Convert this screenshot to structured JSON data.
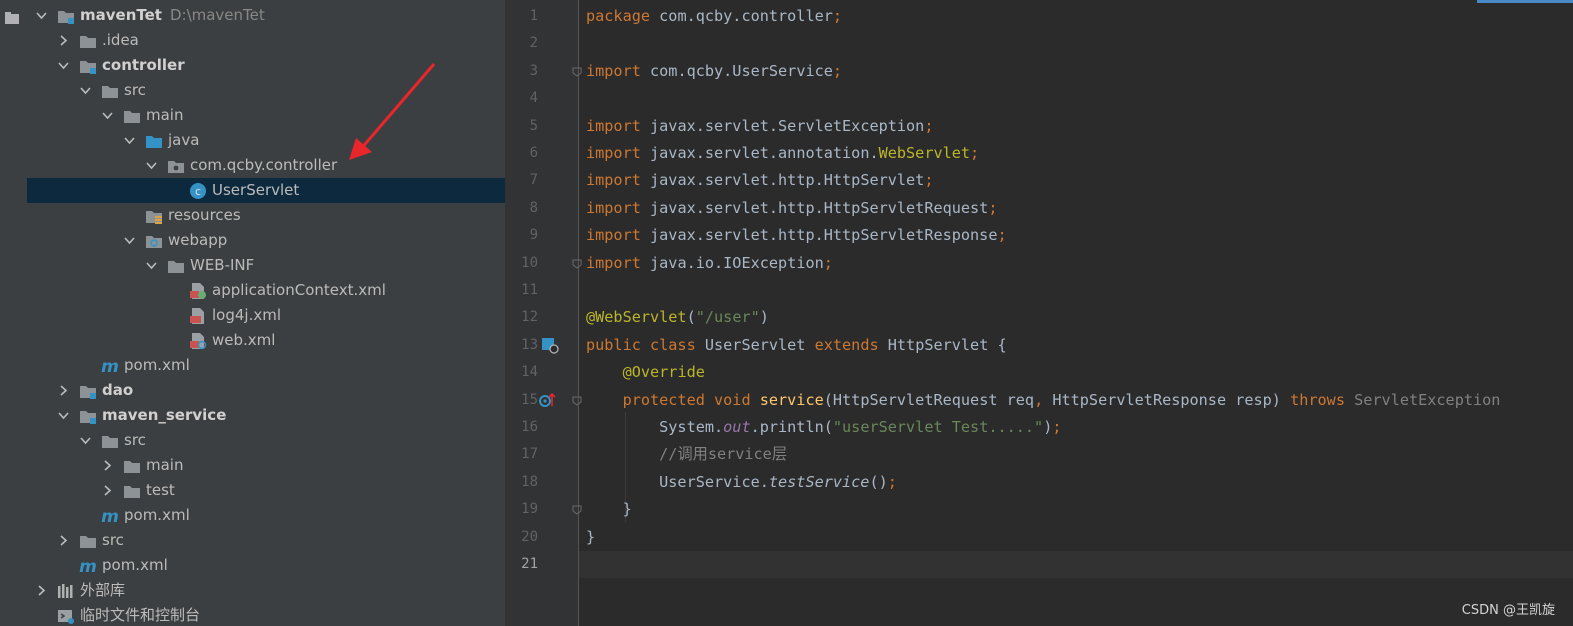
{
  "project_tree": {
    "rows": [
      {
        "label": "mavenTet",
        "path": "D:\\mavenTet",
        "bold": true,
        "indent": 0,
        "chevron": "down",
        "icon": "module-folder-icon"
      },
      {
        "label": ".idea",
        "indent": 1,
        "chevron": "right",
        "icon": "folder-icon"
      },
      {
        "label": "controller",
        "bold": true,
        "indent": 1,
        "chevron": "down",
        "icon": "module-folder-icon"
      },
      {
        "label": "src",
        "indent": 2,
        "chevron": "down",
        "icon": "folder-icon"
      },
      {
        "label": "main",
        "indent": 3,
        "chevron": "down",
        "icon": "folder-icon"
      },
      {
        "label": "java",
        "indent": 4,
        "chevron": "down",
        "icon": "source-folder-icon"
      },
      {
        "label": "com.qcby.controller",
        "indent": 5,
        "chevron": "down",
        "icon": "package-icon"
      },
      {
        "label": "UserServlet",
        "indent": 6,
        "chevron": "none",
        "icon": "class-icon",
        "selected": true
      },
      {
        "label": "resources",
        "indent": 4,
        "chevron": "none",
        "icon": "resources-folder-icon"
      },
      {
        "label": "webapp",
        "indent": 4,
        "chevron": "down",
        "icon": "web-folder-icon"
      },
      {
        "label": "WEB-INF",
        "indent": 5,
        "chevron": "down",
        "icon": "folder-icon"
      },
      {
        "label": "applicationContext.xml",
        "indent": 6,
        "chevron": "none",
        "icon": "spring-xml-icon"
      },
      {
        "label": "log4j.xml",
        "indent": 6,
        "chevron": "none",
        "icon": "xml-file-icon"
      },
      {
        "label": "web.xml",
        "indent": 6,
        "chevron": "none",
        "icon": "web-xml-icon"
      },
      {
        "label": "pom.xml",
        "indent": 2,
        "chevron": "none",
        "icon": "maven-icon"
      },
      {
        "label": "dao",
        "bold": true,
        "indent": 1,
        "chevron": "right",
        "icon": "module-folder-icon"
      },
      {
        "label": "maven_service",
        "bold": true,
        "indent": 1,
        "chevron": "down",
        "icon": "module-folder-icon"
      },
      {
        "label": "src",
        "indent": 2,
        "chevron": "down",
        "icon": "folder-icon"
      },
      {
        "label": "main",
        "indent": 3,
        "chevron": "right",
        "icon": "folder-icon"
      },
      {
        "label": "test",
        "indent": 3,
        "chevron": "right",
        "icon": "folder-icon"
      },
      {
        "label": "pom.xml",
        "indent": 2,
        "chevron": "none",
        "icon": "maven-icon"
      },
      {
        "label": "src",
        "indent": 1,
        "chevron": "right",
        "icon": "folder-icon"
      },
      {
        "label": "pom.xml",
        "indent": 1,
        "chevron": "none",
        "icon": "maven-icon"
      },
      {
        "label": "外部库",
        "indent": 0,
        "chevron": "right",
        "icon": "library-icon"
      },
      {
        "label": "临时文件和控制台",
        "indent": 0,
        "chevron": "none",
        "icon": "scratch-icon"
      }
    ]
  },
  "editor": {
    "current_line": 21,
    "lines": [
      [
        {
          "t": "package ",
          "c": "kw"
        },
        {
          "t": "com.qcby.controller"
        },
        {
          "t": ";",
          "c": "kw"
        }
      ],
      [],
      [
        {
          "t": "import ",
          "c": "kw"
        },
        {
          "t": "com.qcby.UserService"
        },
        {
          "t": ";",
          "c": "kw"
        }
      ],
      [],
      [
        {
          "t": "import ",
          "c": "kw"
        },
        {
          "t": "javax.servlet.ServletException"
        },
        {
          "t": ";",
          "c": "kw"
        }
      ],
      [
        {
          "t": "import ",
          "c": "kw"
        },
        {
          "t": "javax.servlet.annotation."
        },
        {
          "t": "WebServlet",
          "c": "ann"
        },
        {
          "t": ";",
          "c": "kw"
        }
      ],
      [
        {
          "t": "import ",
          "c": "kw"
        },
        {
          "t": "javax.servlet.http.HttpServlet"
        },
        {
          "t": ";",
          "c": "kw"
        }
      ],
      [
        {
          "t": "import ",
          "c": "kw"
        },
        {
          "t": "javax.servlet.http.HttpServletRequest"
        },
        {
          "t": ";",
          "c": "kw"
        }
      ],
      [
        {
          "t": "import ",
          "c": "kw"
        },
        {
          "t": "javax.servlet.http.HttpServletResponse"
        },
        {
          "t": ";",
          "c": "kw"
        }
      ],
      [
        {
          "t": "import ",
          "c": "kw"
        },
        {
          "t": "java.io.IOException"
        },
        {
          "t": ";",
          "c": "kw"
        }
      ],
      [],
      [
        {
          "t": "@WebServlet",
          "c": "ann"
        },
        {
          "t": "("
        },
        {
          "t": "\"/user\"",
          "c": "str"
        },
        {
          "t": ")"
        }
      ],
      [
        {
          "t": "public class ",
          "c": "kw"
        },
        {
          "t": "UserServlet "
        },
        {
          "t": "extends ",
          "c": "kw"
        },
        {
          "t": "HttpServlet {"
        }
      ],
      [
        {
          "t": "    "
        },
        {
          "t": "@Override",
          "c": "ann"
        }
      ],
      [
        {
          "t": "    "
        },
        {
          "t": "protected void ",
          "c": "kw"
        },
        {
          "t": "service",
          "c": "fn"
        },
        {
          "t": "(HttpServletRequest req"
        },
        {
          "t": ", ",
          "c": "kw"
        },
        {
          "t": "HttpServletResponse resp) "
        },
        {
          "t": "throws ",
          "c": "kw"
        },
        {
          "t": "ServletException",
          "c": "dim"
        }
      ],
      [
        {
          "t": "        System."
        },
        {
          "t": "out",
          "c": "field"
        },
        {
          "t": ".println("
        },
        {
          "t": "\"userServlet Test.....\"",
          "c": "str"
        },
        {
          "t": ")"
        },
        {
          "t": ";",
          "c": "kw"
        }
      ],
      [
        {
          "t": "        "
        },
        {
          "t": "//调用service层",
          "c": "cmt"
        }
      ],
      [
        {
          "t": "        UserService."
        },
        {
          "t": "testService",
          "c": "it"
        },
        {
          "t": "()"
        },
        {
          "t": ";",
          "c": "kw"
        }
      ],
      [
        {
          "t": "    }"
        }
      ],
      [
        {
          "t": "}"
        }
      ],
      []
    ]
  },
  "watermark": "CSDN @王凯旋"
}
